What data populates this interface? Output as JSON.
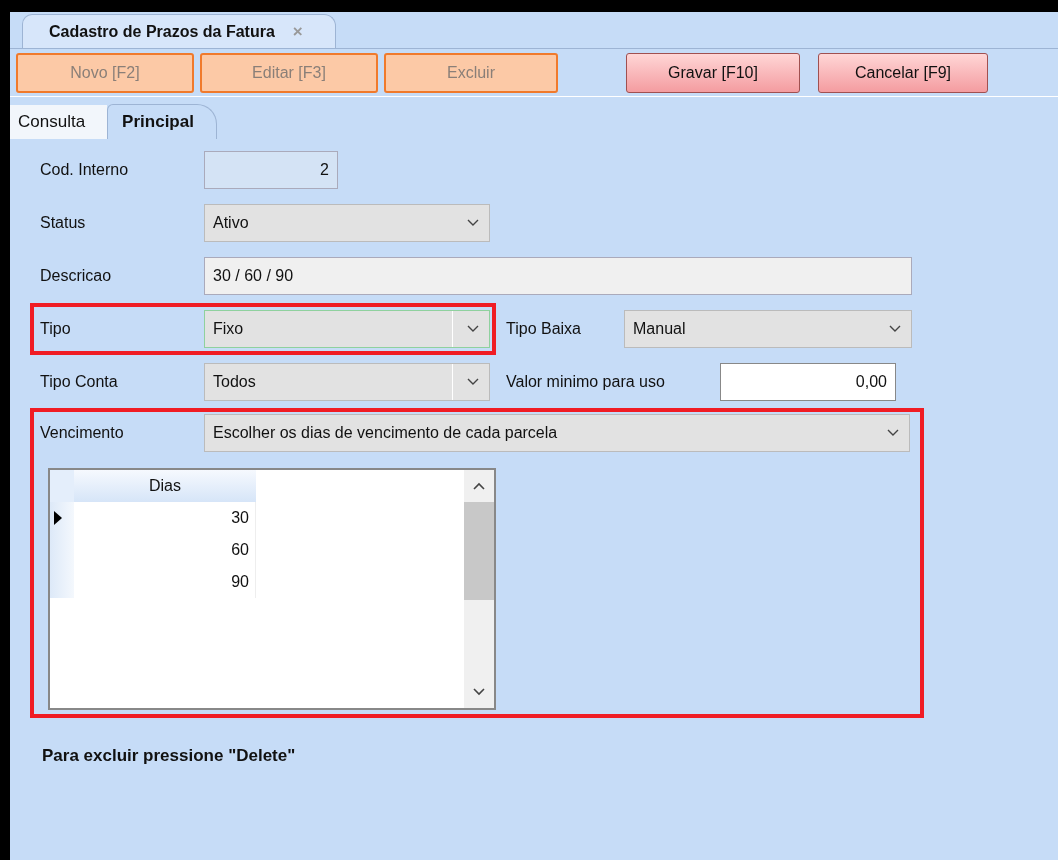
{
  "document_tab": {
    "title": "Cadastro de Prazos da Fatura",
    "close": "×"
  },
  "toolbar": [
    {
      "label": "Novo [F2]",
      "disabled": true
    },
    {
      "label": "Editar [F3]",
      "disabled": true
    },
    {
      "label": "Excluir",
      "disabled": true
    },
    {
      "label": "Gravar [F10]",
      "disabled": false
    },
    {
      "label": "Cancelar [F9]",
      "disabled": false
    }
  ],
  "tabs": [
    {
      "label": "Consulta",
      "selected": false
    },
    {
      "label": "Principal",
      "selected": true
    }
  ],
  "form": {
    "cod_interno": {
      "label": "Cod. Interno",
      "value": "2"
    },
    "status": {
      "label": "Status",
      "value": "Ativo"
    },
    "descricao": {
      "label": "Descricao",
      "value": "30 / 60 / 90"
    },
    "tipo": {
      "label": "Tipo",
      "value": "Fixo",
      "highlighted": true
    },
    "tipo_baixa": {
      "label": "Tipo Baixa",
      "value": "Manual"
    },
    "tipo_conta": {
      "label": "Tipo Conta",
      "value": "Todos"
    },
    "valor_minimo": {
      "label": "Valor minimo para uso",
      "value": "0,00"
    },
    "vencimento": {
      "label": "Vencimento",
      "value": "Escolher os dias de vencimento de cada parcela",
      "highlighted": true
    }
  },
  "grid": {
    "columns": [
      "Dias"
    ],
    "rows": [
      {
        "dias": "30",
        "selected": true
      },
      {
        "dias": "60",
        "selected": false
      },
      {
        "dias": "90",
        "selected": false
      }
    ]
  },
  "hint": "Para excluir pressione \"Delete\""
}
